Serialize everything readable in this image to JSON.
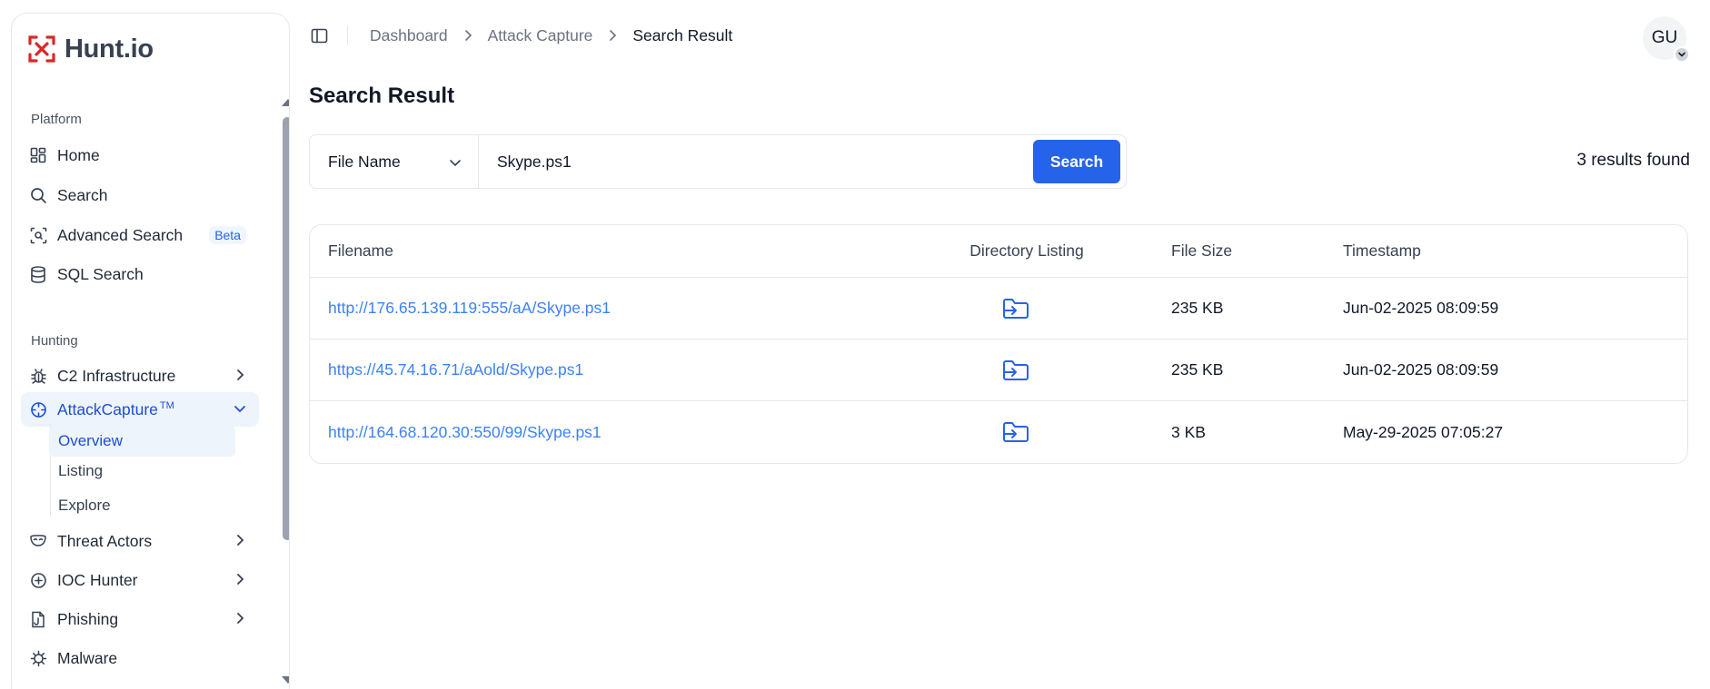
{
  "brand": {
    "name": "Hunt.io"
  },
  "sidebar": {
    "sections": {
      "platform": "Platform",
      "hunting": "Hunting"
    },
    "platform_items": [
      {
        "label": "Home",
        "icon": "dashboard-grid-icon"
      },
      {
        "label": "Search",
        "icon": "search-icon"
      },
      {
        "label": "Advanced Search",
        "icon": "scan-search-icon",
        "badge": "Beta"
      },
      {
        "label": "SQL Search",
        "icon": "database-icon"
      }
    ],
    "hunting_items": [
      {
        "label": "C2 Infrastructure",
        "icon": "bug-icon"
      },
      {
        "label": "AttackCapture",
        "suffix": "TM",
        "icon": "crosshair-icon",
        "active": true
      },
      {
        "label": "Threat Actors",
        "icon": "mask-icon"
      },
      {
        "label": "IOC Hunter",
        "icon": "plus-circle-icon"
      },
      {
        "label": "Phishing",
        "icon": "fishing-file-icon"
      },
      {
        "label": "Malware",
        "icon": "virus-icon"
      }
    ],
    "attackcapture_subitems": [
      {
        "label": "Overview",
        "active": true
      },
      {
        "label": "Listing"
      },
      {
        "label": "Explore"
      }
    ]
  },
  "breadcrumb": [
    "Dashboard",
    "Attack Capture",
    "Search Result"
  ],
  "user": {
    "initials": "GU"
  },
  "page": {
    "title": "Search Result"
  },
  "search": {
    "field_selected": "File Name",
    "query": "Skype.ps1",
    "button_label": "Search",
    "results_text": "3 results found"
  },
  "table": {
    "headers": [
      "Filename",
      "Directory Listing",
      "File Size",
      "Timestamp"
    ],
    "rows": [
      {
        "filename": "http://176.65.139.119:555/aA/Skype.ps1",
        "size": "235 KB",
        "timestamp": "Jun-02-2025 08:09:59"
      },
      {
        "filename": "https://45.74.16.71/aAold/Skype.ps1",
        "size": "235 KB",
        "timestamp": "Jun-02-2025 08:09:59"
      },
      {
        "filename": "http://164.68.120.30:550/99/Skype.ps1",
        "size": "3 KB",
        "timestamp": "May-29-2025 07:05:27"
      }
    ]
  },
  "colors": {
    "accent": "#2563eb",
    "link": "#3b82f6",
    "brand_red": "#dc2626"
  }
}
